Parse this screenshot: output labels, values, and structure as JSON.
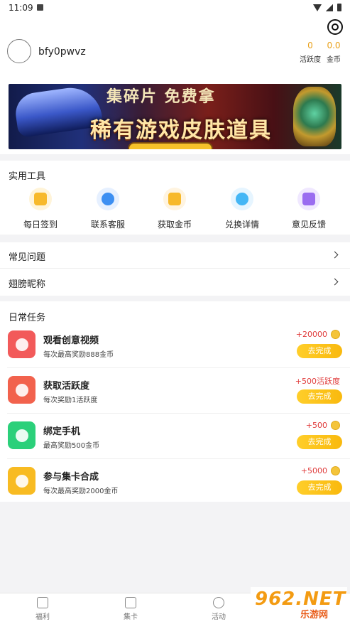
{
  "status_bar": {
    "time": "11:09"
  },
  "profile": {
    "username": "bfy0pwvz",
    "stats": [
      {
        "value": "0",
        "label": "活跃度"
      },
      {
        "value": "0.0",
        "label": "金币"
      }
    ]
  },
  "banner": {
    "headline_top": "集碎片 免费拿",
    "headline_main": "稀有游戏皮肤道具"
  },
  "tools": {
    "title": "实用工具",
    "items": [
      {
        "label": "每日签到",
        "icon": "calendar-icon",
        "color": "#f7b92b",
        "bg": "#fff4d8"
      },
      {
        "label": "联系客服",
        "icon": "headset-icon",
        "color": "#3d8ff2",
        "bg": "#e6f0ff"
      },
      {
        "label": "获取金币",
        "icon": "gift-icon",
        "color": "#f7b92b",
        "bg": "#fff4e0"
      },
      {
        "label": "兑换详情",
        "icon": "diamond-icon",
        "color": "#44b6f5",
        "bg": "#e6f5ff"
      },
      {
        "label": "意见反馈",
        "icon": "card-icon",
        "color": "#9a6cf0",
        "bg": "#f0e8ff"
      }
    ]
  },
  "menu": {
    "items": [
      {
        "label": "常见问题"
      },
      {
        "label": "翅膀昵称"
      }
    ]
  },
  "tasks": {
    "title": "日常任务",
    "items": [
      {
        "name": "观看创意视频",
        "desc": "每次最高奖励888金币",
        "reward": "+20000",
        "action": "去完成",
        "icon": "play-icon",
        "color": "#f25a5a"
      },
      {
        "name": "获取活跃度",
        "desc": "每次奖励1活跃度",
        "reward": "+500活跃度",
        "action": "去完成",
        "icon": "radiation-icon",
        "color": "#f2624d"
      },
      {
        "name": "绑定手机",
        "desc": "最高奖励500金币",
        "reward": "+500",
        "action": "去完成",
        "icon": "phone-icon",
        "color": "#2bd07a"
      },
      {
        "name": "参与集卡合成",
        "desc": "每次最高奖励2000金币",
        "reward": "+5000",
        "action": "去完成",
        "icon": "puzzle-icon",
        "color": "#f8bb22"
      }
    ]
  },
  "tabbar": {
    "items": [
      {
        "label": "福利",
        "icon": "gift-icon"
      },
      {
        "label": "集卡",
        "icon": "card-star-icon"
      },
      {
        "label": "活动",
        "icon": "ball-icon"
      }
    ]
  },
  "watermark": {
    "main": "962.NET",
    "sub": "乐游网"
  }
}
